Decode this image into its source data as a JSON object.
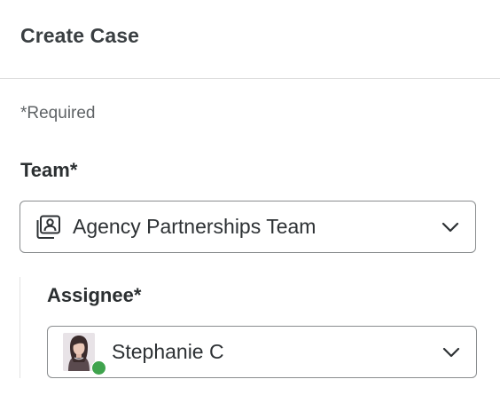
{
  "header": {
    "title": "Create Case"
  },
  "form": {
    "required_note": "*Required",
    "team": {
      "label": "Team*",
      "value": "Agency Partnerships Team",
      "icon": "team-icon"
    },
    "assignee": {
      "label": "Assignee*",
      "value": "Stephanie C",
      "avatar": "user-avatar",
      "status": "online",
      "status_color": "#3fa34d"
    }
  }
}
